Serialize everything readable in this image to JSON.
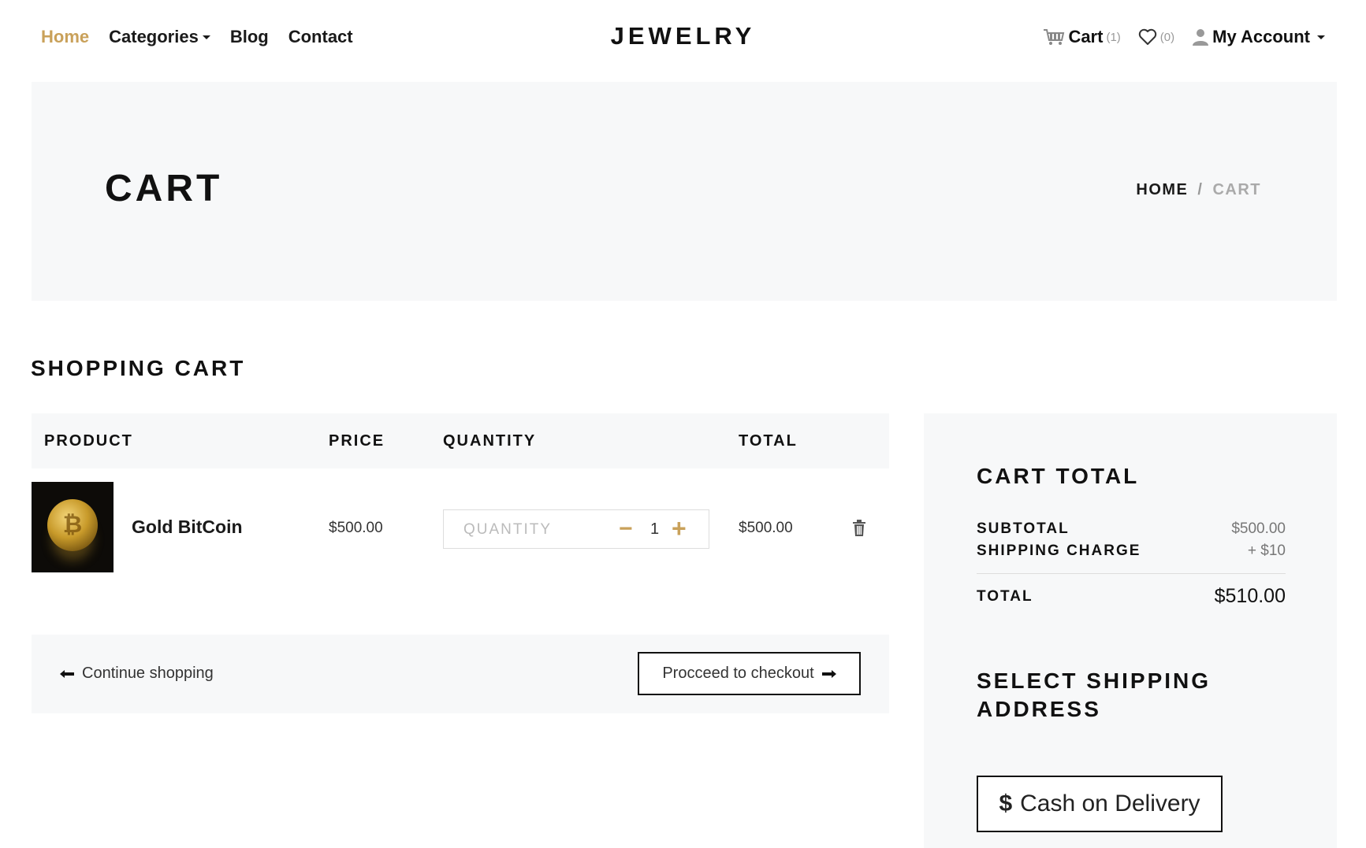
{
  "nav": {
    "home": "Home",
    "categories": "Categories",
    "blog": "Blog",
    "contact": "Contact",
    "logo": "JEWELRY",
    "cart_label": "Cart",
    "cart_count": "(1)",
    "wishlist_count": "(0)",
    "account": "My Account"
  },
  "banner": {
    "title": "CART",
    "breadcrumb_home": "HOME",
    "breadcrumb_sep": "/",
    "breadcrumb_current": "CART"
  },
  "cart": {
    "section_title": "SHOPPING CART",
    "headers": {
      "product": "PRODUCT",
      "price": "PRICE",
      "quantity": "QUANTITY",
      "total": "TOTAL"
    },
    "items": [
      {
        "name": "Gold BitCoin",
        "price": "$500.00",
        "quantity_placeholder": "QUANTITY",
        "quantity": "1",
        "total": "$500.00"
      }
    ],
    "continue_label": "Continue shopping",
    "checkout_label": "Procceed to checkout"
  },
  "summary": {
    "title": "CART TOTAL",
    "subtotal_label": "SUBTOTAL",
    "subtotal_value": "$500.00",
    "shipping_label": "SHIPPING CHARGE",
    "shipping_value": "+ $10",
    "total_label": "TOTAL",
    "total_value": "$510.00",
    "shipping_address_title": "SELECT SHIPPING ADDRESS",
    "cod_symbol": "$",
    "cod_label": "Cash on Delivery"
  },
  "colors": {
    "accent": "#c9a15a",
    "panel_bg": "#f7f8f9",
    "text": "#111111"
  },
  "icons": {
    "cart": "cart-icon",
    "wishlist": "heart-icon",
    "account": "user-icon",
    "delete": "trash-icon",
    "back": "arrow-left-icon",
    "forward": "arrow-right-icon"
  }
}
